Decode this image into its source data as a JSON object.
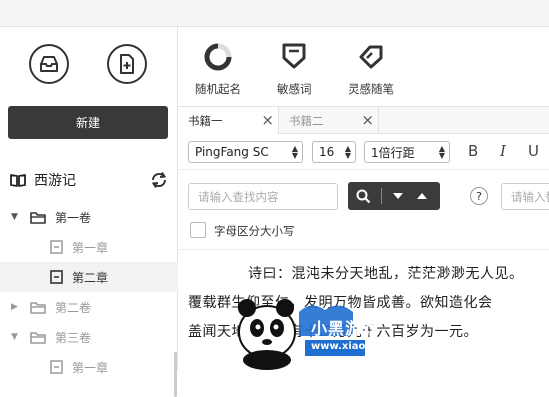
{
  "sidebar": {
    "new_button": "新建",
    "book": {
      "title": "西游记"
    },
    "tree": [
      {
        "type": "volume",
        "label": "第一卷",
        "expanded": true,
        "muted": false
      },
      {
        "type": "chapter",
        "label": "第一章",
        "selected": false,
        "muted": true
      },
      {
        "type": "chapter",
        "label": "第二章",
        "selected": true,
        "muted": false
      },
      {
        "type": "volume",
        "label": "第二卷",
        "expanded": false,
        "muted": true
      },
      {
        "type": "volume",
        "label": "第三卷",
        "expanded": true,
        "muted": true
      },
      {
        "type": "chapter",
        "label": "第一章",
        "selected": false,
        "muted": true
      }
    ]
  },
  "toolbar": {
    "random_name": "随机起名",
    "sensitive_words": "敏感词",
    "inspiration_notes": "灵感随笔"
  },
  "tabs": [
    {
      "label": "书籍一",
      "active": true
    },
    {
      "label": "书籍二",
      "active": false
    }
  ],
  "format": {
    "font_family": "PingFang SC",
    "font_size": "16",
    "line_spacing": "1倍行距",
    "bold": "B",
    "italic": "I",
    "underline": "U"
  },
  "find": {
    "search_placeholder": "请输入查找内容",
    "help": "?",
    "replace_placeholder": "请输入替换内容",
    "case_sensitive_label": "字母区分大小写"
  },
  "editor": {
    "lines": [
      "诗曰：混沌未分天地乱，茫茫渺渺无人见。",
      "覆载群生仰至仁，发明万物皆成善。欲知造化会",
      "盖闻天地之数，有十二万九千六百岁为一元。"
    ]
  },
  "watermark": {
    "brand": "小黑游戏",
    "url": "www.xiaohei.com"
  },
  "colors": {
    "dark_button": "#393939",
    "selected_row": "#f2f2f2",
    "watermark_blue": "#1f6fd0"
  }
}
